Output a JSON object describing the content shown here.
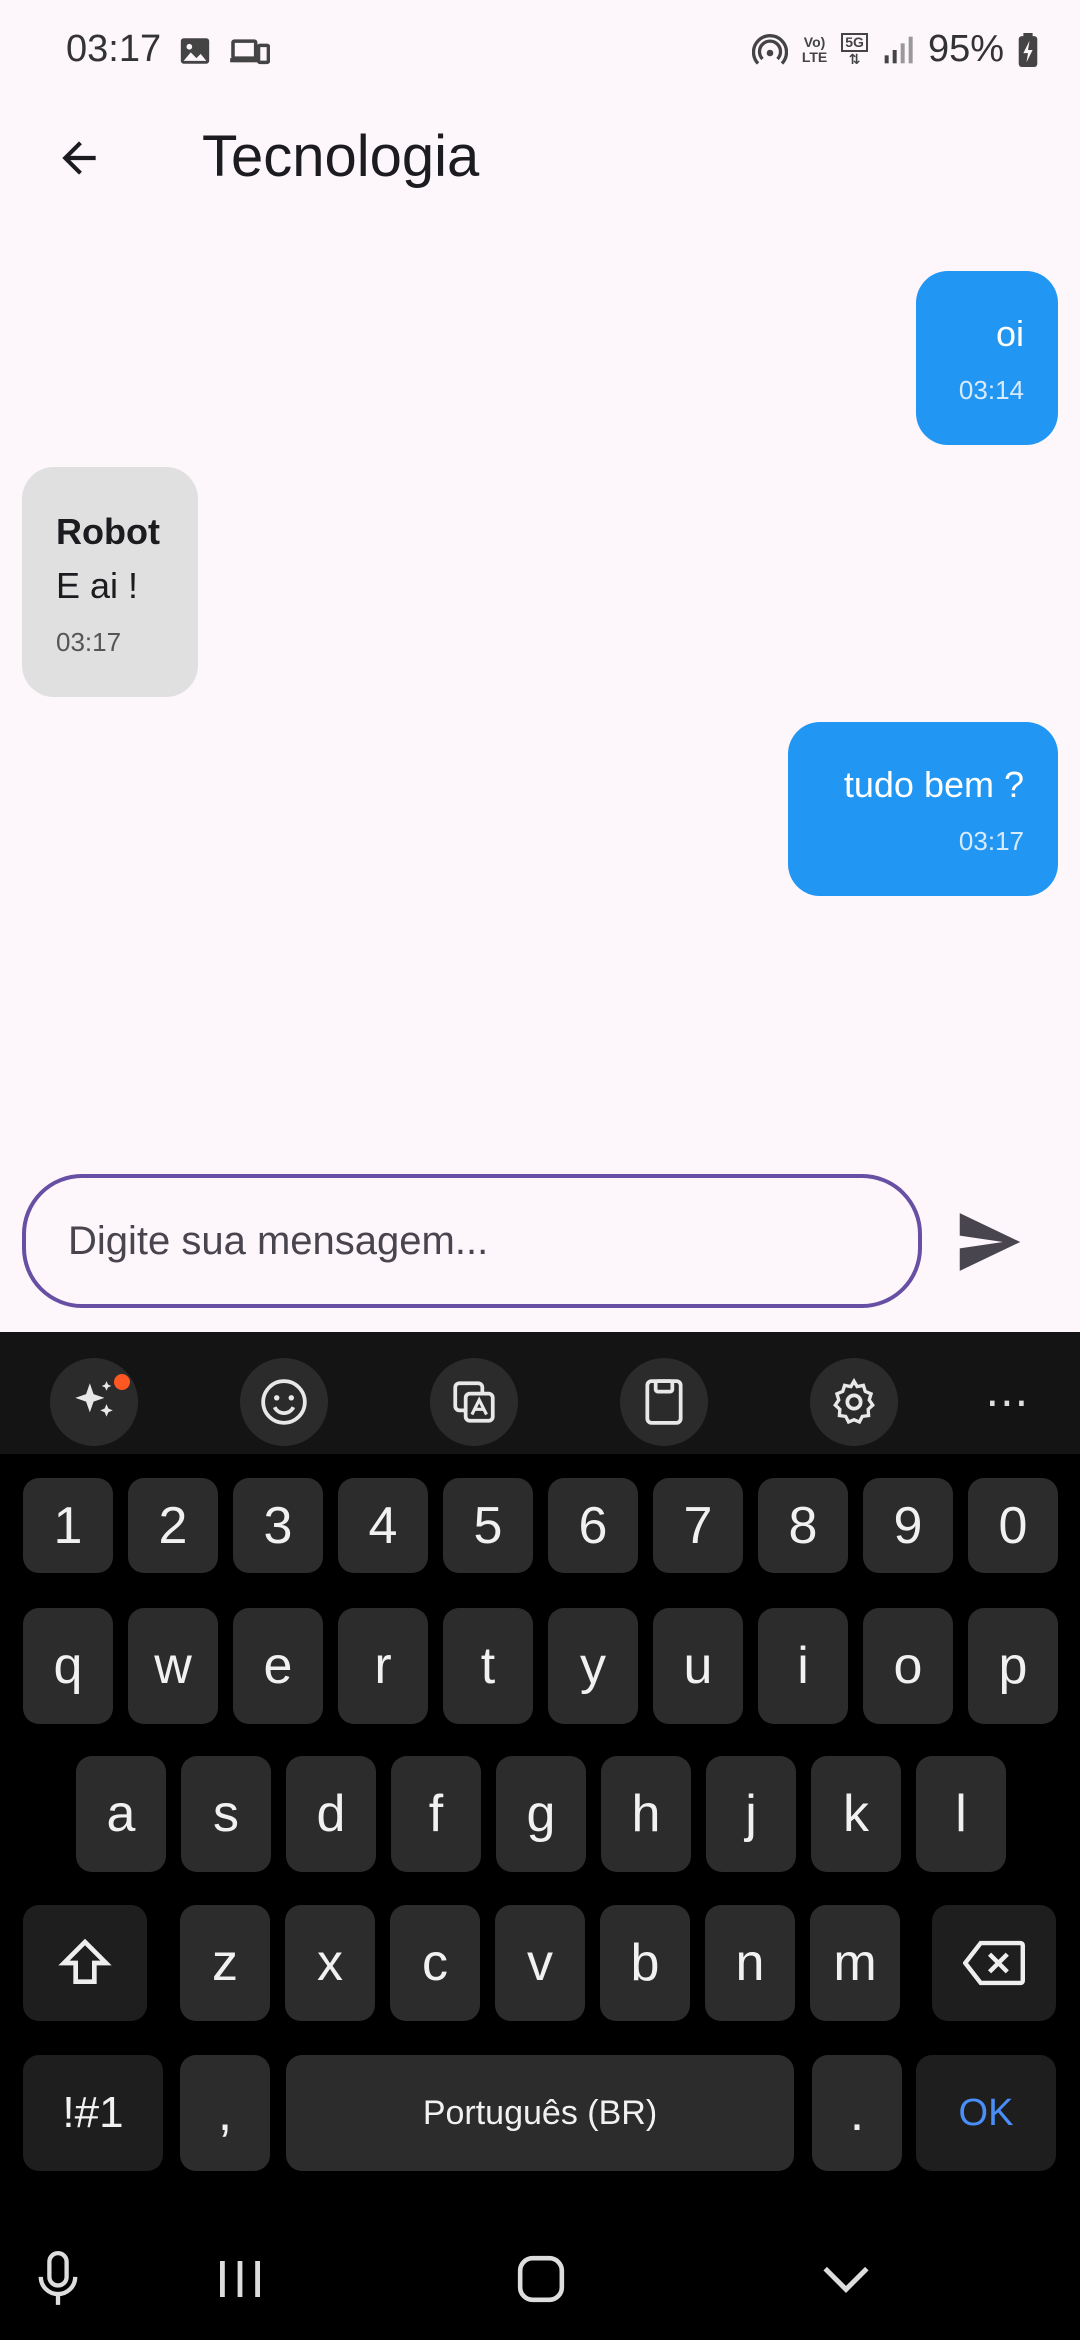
{
  "status": {
    "time": "03:17",
    "battery": "95%",
    "volte_top": "Vo)",
    "volte_bottom": "LTE",
    "fiveg": "5G"
  },
  "app_bar": {
    "title": "Tecnologia"
  },
  "messages": [
    {
      "sender": "",
      "text": "oi",
      "time": "03:14",
      "from_me": true
    },
    {
      "sender": "Robot",
      "text": "E ai !",
      "time": "03:17",
      "from_me": false
    },
    {
      "sender": "",
      "text": "tudo bem ?",
      "time": "03:17",
      "from_me": true
    }
  ],
  "composer": {
    "placeholder": "Digite sua mensagem..."
  },
  "keyboard": {
    "number_row": [
      "1",
      "2",
      "3",
      "4",
      "5",
      "6",
      "7",
      "8",
      "9",
      "0"
    ],
    "row1": [
      "q",
      "w",
      "e",
      "r",
      "t",
      "y",
      "u",
      "i",
      "o",
      "p"
    ],
    "row2": [
      "a",
      "s",
      "d",
      "f",
      "g",
      "h",
      "j",
      "k",
      "l"
    ],
    "row3": [
      "z",
      "x",
      "c",
      "v",
      "b",
      "n",
      "m"
    ],
    "symbols_label": "!#1",
    "comma": ",",
    "space_label": "Português (BR)",
    "period": ".",
    "ok_label": "OK",
    "more_label": "⋯"
  },
  "colors": {
    "my_bubble": "#2196f3",
    "bot_bubble": "#e0e0e0",
    "input_border": "#6750a4",
    "ok_key": "#4a8ff7"
  }
}
